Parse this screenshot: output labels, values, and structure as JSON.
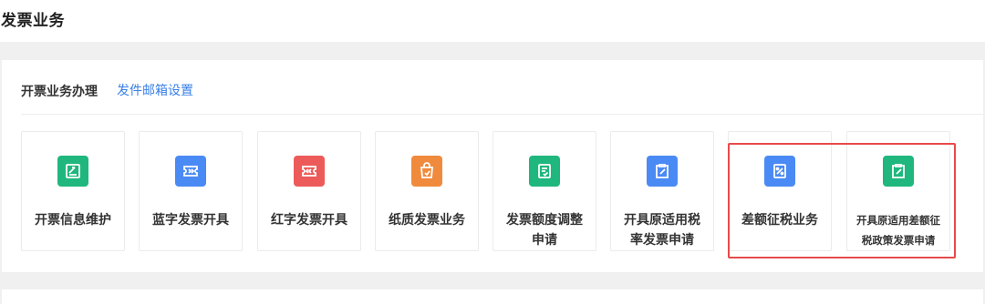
{
  "page": {
    "title": "发票业务"
  },
  "section": {
    "title": "开票业务办理",
    "link": "发件邮箱设置"
  },
  "cards": [
    {
      "label": "开票信息维护",
      "icon": "edit-doc-icon",
      "color": "#1fb77d"
    },
    {
      "label": "蓝字发票开具",
      "icon": "blue-ticket-icon",
      "color": "#4a8af4"
    },
    {
      "label": "红字发票开具",
      "icon": "red-ticket-icon",
      "color": "#ec5a5a"
    },
    {
      "label": "纸质发票业务",
      "icon": "paper-bag-icon",
      "color": "#f08a3c"
    },
    {
      "label": "发票额度调整\n申请",
      "icon": "quota-doc-icon",
      "color": "#1fb77d"
    },
    {
      "label": "开具原适用税\n率发票申请",
      "icon": "clipboard-edit-icon",
      "color": "#4a8af4"
    },
    {
      "label": "差额征税业务",
      "icon": "percent-doc-icon",
      "color": "#4a8af4"
    },
    {
      "label": "开具原适用差额征\n税政策发票申请",
      "icon": "clipboard-edit-icon",
      "color": "#1fb77d"
    }
  ],
  "highlight_color": "#e84a4a"
}
